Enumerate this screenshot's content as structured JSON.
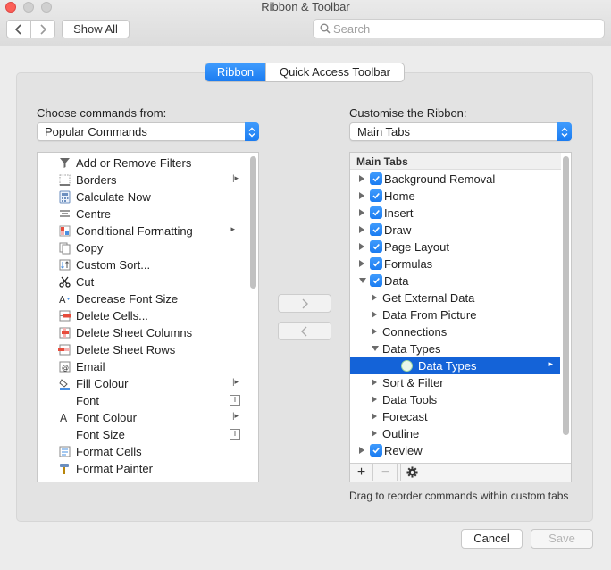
{
  "window": {
    "title": "Ribbon & Toolbar"
  },
  "toolbar": {
    "show_all": "Show All",
    "search_placeholder": "Search"
  },
  "tabs": {
    "ribbon": "Ribbon",
    "quick_access": "Quick Access Toolbar"
  },
  "left": {
    "label": "Choose commands from:",
    "dropdown_value": "Popular Commands",
    "commands": [
      {
        "label": "Add or Remove Filters",
        "icon": "filter-icon",
        "submenu": ""
      },
      {
        "label": "Borders",
        "icon": "borders-icon",
        "submenu": "split"
      },
      {
        "label": "Calculate Now",
        "icon": "calculator-icon",
        "submenu": ""
      },
      {
        "label": "Centre",
        "icon": "align-center-icon",
        "submenu": ""
      },
      {
        "label": "Conditional Formatting",
        "icon": "conditional-formatting-icon",
        "submenu": "arrow"
      },
      {
        "label": "Copy",
        "icon": "copy-icon",
        "submenu": ""
      },
      {
        "label": "Custom Sort...",
        "icon": "sort-icon",
        "submenu": ""
      },
      {
        "label": "Cut",
        "icon": "scissors-icon",
        "submenu": ""
      },
      {
        "label": "Decrease Font Size",
        "icon": "decrease-font-icon",
        "submenu": ""
      },
      {
        "label": "Delete Cells...",
        "icon": "delete-cells-icon",
        "submenu": ""
      },
      {
        "label": "Delete Sheet Columns",
        "icon": "delete-columns-icon",
        "submenu": ""
      },
      {
        "label": "Delete Sheet Rows",
        "icon": "delete-rows-icon",
        "submenu": ""
      },
      {
        "label": "Email",
        "icon": "email-icon",
        "submenu": ""
      },
      {
        "label": "Fill Colour",
        "icon": "fill-colour-icon",
        "submenu": "split"
      },
      {
        "label": "Font",
        "icon": "",
        "submenu": "box"
      },
      {
        "label": "Font Colour",
        "icon": "font-colour-icon",
        "submenu": "split"
      },
      {
        "label": "Font Size",
        "icon": "",
        "submenu": "box"
      },
      {
        "label": "Format Cells",
        "icon": "format-cells-icon",
        "submenu": ""
      },
      {
        "label": "Format Painter",
        "icon": "format-painter-icon",
        "submenu": ""
      }
    ]
  },
  "right": {
    "label": "Customise the Ribbon:",
    "dropdown_value": "Main Tabs",
    "tree_header": "Main Tabs",
    "items": [
      {
        "label": "Background Removal",
        "level": 0,
        "checked": true,
        "expanded": false
      },
      {
        "label": "Home",
        "level": 0,
        "checked": true,
        "expanded": false
      },
      {
        "label": "Insert",
        "level": 0,
        "checked": true,
        "expanded": false
      },
      {
        "label": "Draw",
        "level": 0,
        "checked": true,
        "expanded": false
      },
      {
        "label": "Page Layout",
        "level": 0,
        "checked": true,
        "expanded": false
      },
      {
        "label": "Formulas",
        "level": 0,
        "checked": true,
        "expanded": false
      },
      {
        "label": "Data",
        "level": 0,
        "checked": true,
        "expanded": true
      },
      {
        "label": "Get External Data",
        "level": 1,
        "checked": false,
        "expanded": false
      },
      {
        "label": "Data From Picture",
        "level": 1,
        "checked": false,
        "expanded": false
      },
      {
        "label": "Connections",
        "level": 1,
        "checked": false,
        "expanded": false
      },
      {
        "label": "Data Types",
        "level": 1,
        "checked": false,
        "expanded": true
      },
      {
        "label": "Data Types",
        "level": 2,
        "checked": false,
        "expanded": false,
        "selected": true
      },
      {
        "label": "Sort & Filter",
        "level": 1,
        "checked": false,
        "expanded": false
      },
      {
        "label": "Data Tools",
        "level": 1,
        "checked": false,
        "expanded": false
      },
      {
        "label": "Forecast",
        "level": 1,
        "checked": false,
        "expanded": false
      },
      {
        "label": "Outline",
        "level": 1,
        "checked": false,
        "expanded": false
      },
      {
        "label": "Review",
        "level": 0,
        "checked": true,
        "expanded": false
      }
    ],
    "add_label": "+",
    "remove_label": "−",
    "hint": "Drag to reorder commands within custom tabs"
  },
  "buttons": {
    "cancel": "Cancel",
    "save": "Save"
  },
  "colors": {
    "accent": "#1b7cf1",
    "selection": "#1463d8",
    "close": "#fc5f57"
  }
}
